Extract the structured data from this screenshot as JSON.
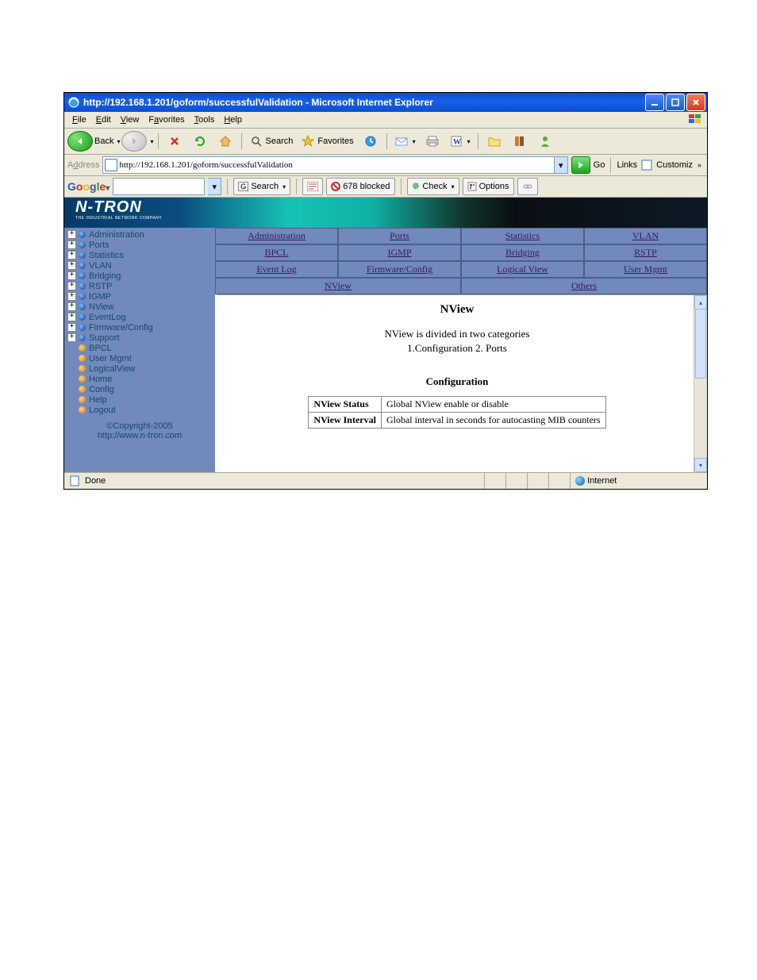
{
  "window": {
    "title": "http://192.168.1.201/goform/successfulValidation - Microsoft Internet Explorer"
  },
  "menu": {
    "file": "File",
    "edit": "Edit",
    "view": "View",
    "favorites": "Favorites",
    "tools": "Tools",
    "help": "Help"
  },
  "toolbar": {
    "back": "Back",
    "search": "Search",
    "favorites": "Favorites"
  },
  "address": {
    "label": "Address",
    "url": "http://192.168.1.201/goform/successfulValidation",
    "go": "Go",
    "links": "Links",
    "customize": "Customiz"
  },
  "google": {
    "search": "Search",
    "blocked": "678 blocked",
    "check": "Check",
    "options": "Options"
  },
  "logo": {
    "name": "N-TRON",
    "tag": "THE INDUSTRIAL NETWORK COMPANY"
  },
  "tree": {
    "items": [
      {
        "label": "Administration",
        "exp": true,
        "blue": true
      },
      {
        "label": "Ports",
        "exp": true,
        "blue": true
      },
      {
        "label": "Statistics",
        "exp": true,
        "blue": true
      },
      {
        "label": "VLAN",
        "exp": true,
        "blue": true
      },
      {
        "label": "Bridging",
        "exp": true,
        "blue": true
      },
      {
        "label": "RSTP",
        "exp": true,
        "blue": true
      },
      {
        "label": "IGMP",
        "exp": true,
        "blue": true
      },
      {
        "label": "NView",
        "exp": true,
        "blue": true
      },
      {
        "label": "EventLog",
        "exp": true,
        "blue": true
      },
      {
        "label": "Firmware/Config",
        "exp": true,
        "blue": true
      },
      {
        "label": "Support",
        "exp": true,
        "blue": true
      },
      {
        "label": "BPCL",
        "exp": false,
        "blue": false
      },
      {
        "label": "User Mgmt",
        "exp": false,
        "blue": false
      },
      {
        "label": "LogicalView",
        "exp": false,
        "blue": false
      },
      {
        "label": "Home",
        "exp": false,
        "blue": false
      },
      {
        "label": "Config",
        "exp": false,
        "blue": false
      },
      {
        "label": "Help",
        "exp": false,
        "blue": false
      },
      {
        "label": "Logout",
        "exp": false,
        "blue": false
      }
    ],
    "copyright": "©Copyright-2005",
    "url": "http://www.n-tron.com"
  },
  "tabs": {
    "r1": [
      "Administration",
      "Ports",
      "Statistics",
      "VLAN"
    ],
    "r2": [
      "BPCL",
      "IGMP",
      "Bridging",
      "RSTP"
    ],
    "r3": [
      "Event Log",
      "Firmware/Config",
      "Logical View",
      "User Mgmt"
    ],
    "r4": [
      "NView",
      "Others"
    ]
  },
  "page": {
    "title": "NView",
    "intro": "NView is divided in two categories",
    "cats": "1.Configuration   2. Ports",
    "section": "Configuration",
    "rows": [
      {
        "k": "NView Status",
        "v": "Global NView enable or disable"
      },
      {
        "k": "NView Interval",
        "v": "Global interval in seconds for autocasting MIB counters"
      }
    ]
  },
  "status": {
    "done": "Done",
    "zone": "Internet"
  }
}
